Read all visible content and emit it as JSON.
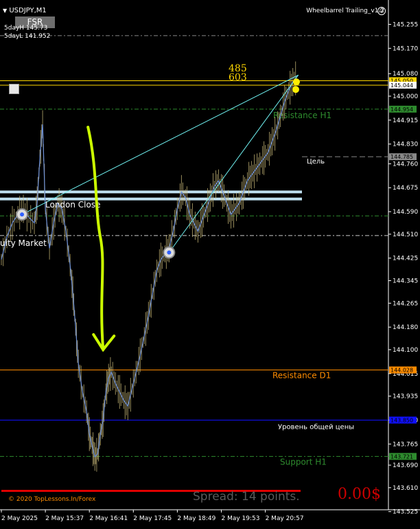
{
  "window": {
    "symbol_title": "USDJPY,M1",
    "ea_name": "Wheelbarrel Trailing_v1.2",
    "ea_icon": "smiley-icon",
    "fsr_button": "FSR",
    "day_high": "5dayH 145.73",
    "day_low": "5dayL 141.952",
    "copyright": "© 2020 TopLessons.In/Forex",
    "spread": "Spread: 14 points.",
    "profit": "0.00$"
  },
  "colors": {
    "background": "#000000",
    "price_line": "#6b8fd8",
    "candle_body": "#c8b878",
    "resistance_h1": "#2e8b2e",
    "resistance_d1": "#ff8c00",
    "level_blue": "#1010ff",
    "yellow_level": "#ffd700",
    "channel": "#bfe0f0",
    "arrow": "#ccff00",
    "spread_text": "#5a5a5a",
    "profit_text": "#cc0000",
    "bottom_bar": "#e00000"
  },
  "chart_data": {
    "type": "line",
    "symbol": "USDJPY",
    "timeframe": "M1",
    "ylim": [
      143.5,
      145.3
    ],
    "y_ticks": [
      "145.255",
      "145.170",
      "145.080",
      "145.000",
      "144.915",
      "144.830",
      "144.760",
      "144.675",
      "144.590",
      "144.510",
      "144.425",
      "144.345",
      "144.265",
      "144.180",
      "144.100",
      "144.015",
      "143.935",
      "143.850",
      "143.765",
      "143.690",
      "143.610",
      "143.525"
    ],
    "x_ticks": [
      "2 May 2025",
      "2 May 15:37",
      "2 May 16:41",
      "2 May 17:45",
      "2 May 18:49",
      "2 May 19:53",
      "2 May 20:57"
    ],
    "x_tick_values": [
      0,
      64,
      128,
      192,
      256,
      320,
      384
    ],
    "price_series": {
      "x": [
        0,
        8,
        16,
        24,
        32,
        40,
        48,
        52,
        56,
        60,
        64,
        70,
        76,
        82,
        88,
        94,
        100,
        104,
        108,
        112,
        118,
        124,
        128,
        132,
        136,
        140,
        144,
        148,
        152,
        156,
        160,
        166,
        172,
        178,
        184,
        190,
        196,
        202,
        208,
        214,
        220,
        226,
        232,
        238,
        244,
        250,
        256,
        262,
        268,
        274,
        280,
        286,
        292,
        298,
        304,
        310,
        316,
        322,
        328,
        334,
        340,
        346,
        352,
        358,
        364,
        370,
        376,
        382,
        388,
        394,
        400,
        406,
        412,
        418,
        424,
        430
      ],
      "y": [
        144.42,
        144.5,
        144.55,
        144.58,
        144.6,
        144.57,
        144.55,
        144.62,
        144.78,
        144.9,
        144.6,
        144.46,
        144.55,
        144.62,
        144.6,
        144.52,
        144.4,
        144.3,
        144.18,
        144.05,
        143.95,
        143.88,
        143.8,
        143.76,
        143.72,
        143.73,
        143.8,
        143.85,
        143.95,
        144.0,
        144.02,
        143.98,
        143.95,
        143.92,
        143.9,
        143.96,
        144.02,
        144.08,
        144.15,
        144.22,
        144.3,
        144.38,
        144.42,
        144.44,
        144.46,
        144.52,
        144.6,
        144.66,
        144.64,
        144.58,
        144.55,
        144.52,
        144.56,
        144.6,
        144.64,
        144.68,
        144.7,
        144.66,
        144.62,
        144.58,
        144.6,
        144.62,
        144.66,
        144.7,
        144.72,
        144.74,
        144.76,
        144.78,
        144.8,
        144.84,
        144.88,
        144.93,
        144.98,
        145.02,
        145.05,
        145.07
      ]
    },
    "levels": [
      {
        "label": "Resistance H1",
        "price": 144.954,
        "price_tag": "144.954",
        "style": "dash-dot",
        "color": "#2e8b2e",
        "label_color": "#2e8b2e"
      },
      {
        "label": "Resistance D1",
        "price": 144.028,
        "price_tag": "144.028",
        "style": "solid",
        "color": "#ff8c00",
        "label_color": "#ff8c00"
      },
      {
        "label": "Уровень общей цены",
        "price": 143.85,
        "price_tag": "143.850",
        "style": "solid",
        "color": "#1010ff",
        "label_color": "#ffffff"
      },
      {
        "label": "Support H1",
        "price": 143.721,
        "price_tag": "143.721",
        "style": "dash-dot",
        "color": "#2e8b2e",
        "label_color": "#2e8b2e"
      },
      {
        "label": "Цель",
        "price": 144.785,
        "price_tag": "144.785",
        "style": "dash",
        "color": "#888888",
        "label_color": "#ffffff"
      }
    ],
    "extra_lines": [
      {
        "price": 145.215,
        "style": "dash-dot",
        "color": "#888888"
      },
      {
        "price": 144.575,
        "style": "dash-dot",
        "color": "#2e8b2e"
      },
      {
        "price": 144.505,
        "style": "dash-dot",
        "color": "#cccccc"
      }
    ],
    "yellow_lines": [
      {
        "price": 145.05,
        "price_tag": "145.050"
      },
      {
        "price": 145.044,
        "price_tag": "145.044"
      }
    ],
    "yellow_labels": [
      "485",
      "603"
    ],
    "session_labels": [
      "London Close",
      "uity Market"
    ],
    "channel_prices": [
      144.66,
      144.635
    ],
    "trendlines": [
      {
        "from": [
          30,
          144.58
        ],
        "to": [
          432,
          145.075
        ]
      },
      {
        "from": [
          244,
          144.445
        ],
        "to": [
          432,
          145.075
        ]
      }
    ],
    "markers": [
      {
        "x": 30,
        "price": 144.58
      },
      {
        "x": 244,
        "price": 144.445
      }
    ],
    "arrow": {
      "from": [
        126,
        144.89
      ],
      "to": [
        148,
        144.1
      ]
    },
    "current_price": 145.044
  }
}
